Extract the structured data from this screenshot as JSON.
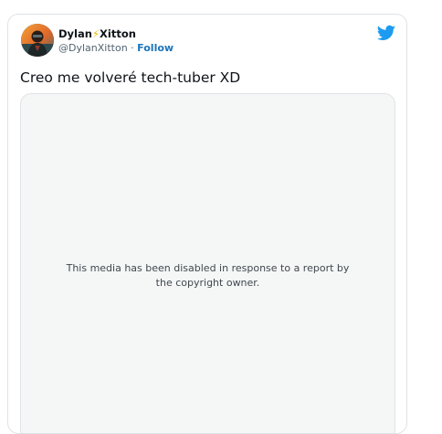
{
  "tweet": {
    "author": {
      "display_name_part1": "Dylan",
      "display_name_emoji": "⚡",
      "display_name_part2": "Xitton",
      "handle": "@DylanXitton",
      "separator": "·",
      "follow_label": "Follow"
    },
    "text": "Creo me volveré tech-tuber XD",
    "media": {
      "disabled_message": "This media has been disabled in response to a report by the copyright owner."
    }
  },
  "icons": {
    "brand": "twitter-bird-icon",
    "emoji": "lightning-bolt-icon"
  },
  "colors": {
    "twitter_blue": "#1d9bf0",
    "follow_link": "#1b75bb",
    "name_text": "#0f1419",
    "handle_text": "#536471",
    "media_background": "#f5f7f7",
    "border": "#dfe3e7"
  }
}
